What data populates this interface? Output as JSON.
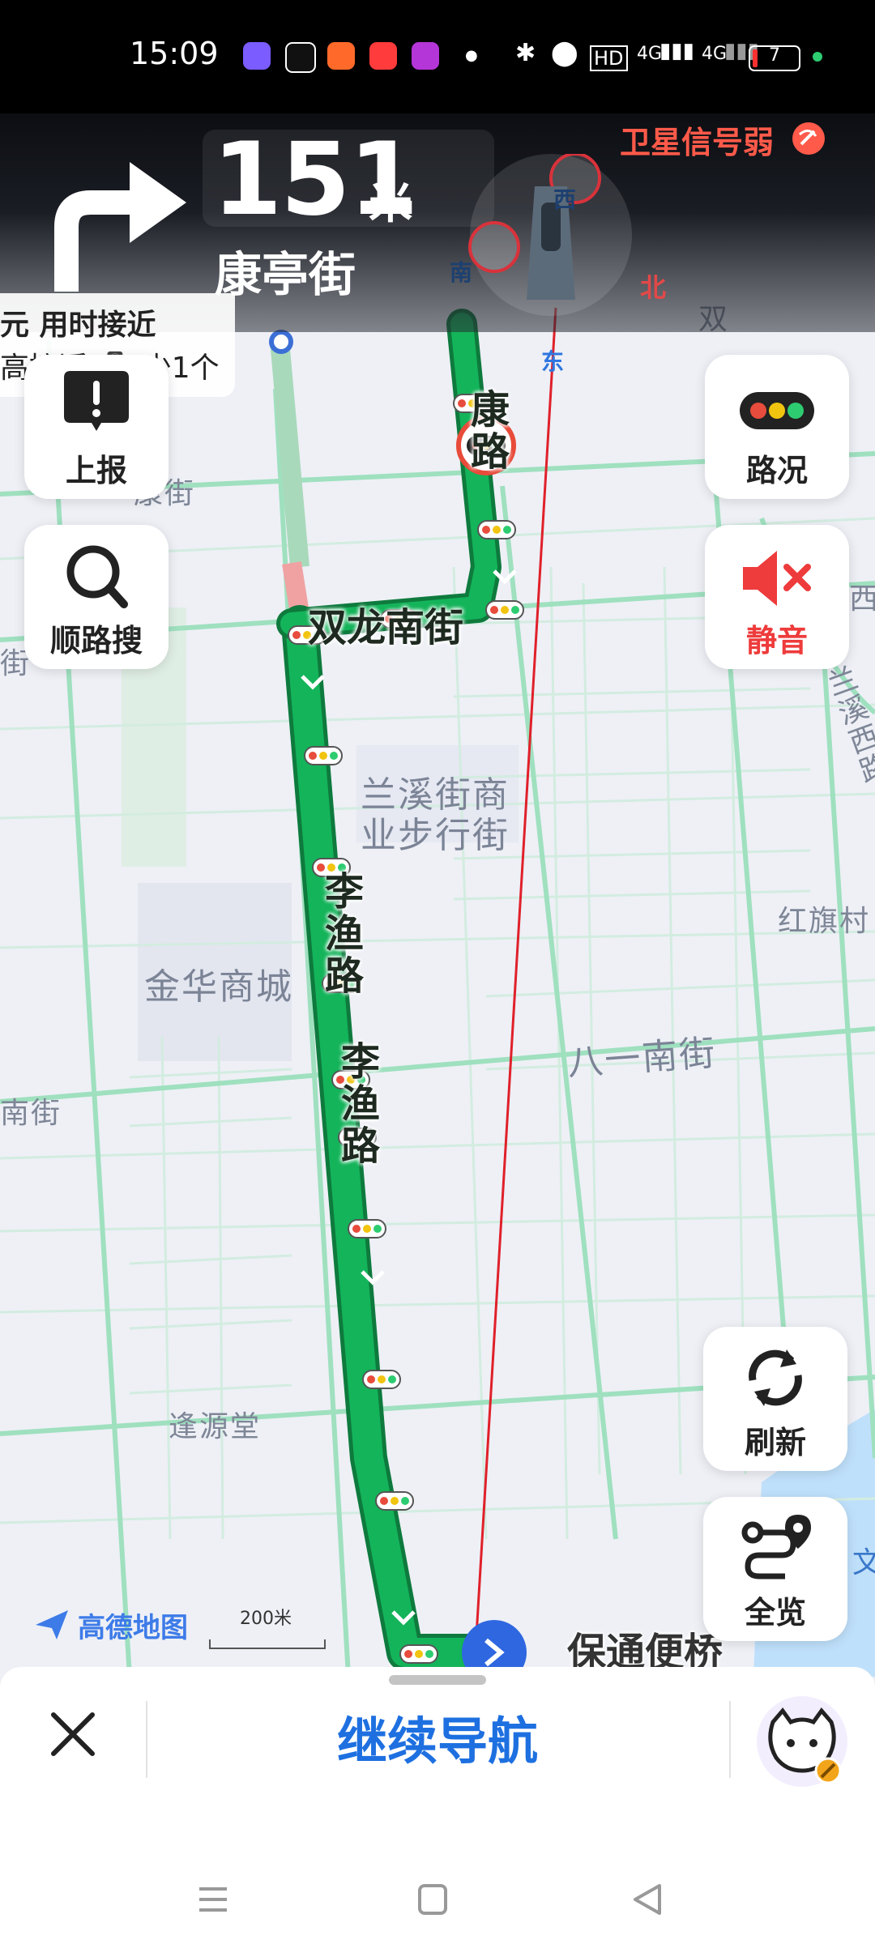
{
  "status_bar": {
    "time": "15:09",
    "network_label": "4G",
    "battery": "7"
  },
  "guidance": {
    "turn_icon": "turn-right-arrow",
    "distance_value": "151",
    "distance_unit": "米",
    "street": "康亭街",
    "gps_warning": "卫星信号弱"
  },
  "route_tip": {
    "line1": "元 用时接近",
    "line2": "高接近 🚦 少1个"
  },
  "compass": {
    "north": "北",
    "east": "东",
    "south": "南",
    "west": "西"
  },
  "side_buttons": {
    "report": "上报",
    "search_along": "顺路搜",
    "traffic": "路况",
    "mute": "静音",
    "refresh": "刷新",
    "overview": "全览"
  },
  "map_labels": {
    "kangjie": "康街",
    "shuanglong_nanjie": "双龙南街",
    "lanxi_pedestrian_1": "兰溪街商",
    "lanxi_pedestrian_2": "业步行街",
    "liyu_road_top": "李渔路",
    "liyu_road_mid": "李渔路",
    "jinhua_mall": "金华商城",
    "bayi_nanjie": "八一南街",
    "hongqi_cun": "红旗村",
    "fengyuan_tang": "逢源堂",
    "baotong_bridge": "保通便桥",
    "lanxi_xilu": "兰溪西路",
    "shuang_partial": "双",
    "xi_partial": "西",
    "jie_left": "南街",
    "jie_left2": "街",
    "kang_road": "康路",
    "wen": "文"
  },
  "map_footer": {
    "brand": "高德地图",
    "scale": "200米"
  },
  "bottom_sheet": {
    "continue_label": "继续导航"
  },
  "colors": {
    "route_green": "#14b45a",
    "warning_red": "#ff4d3d",
    "accent_blue": "#1e70e0"
  }
}
